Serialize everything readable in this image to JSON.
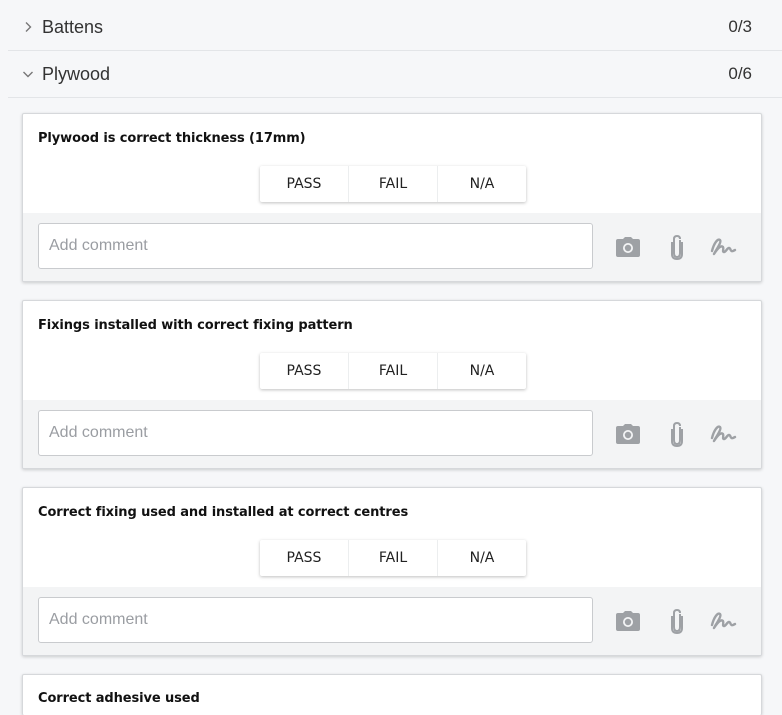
{
  "sections": [
    {
      "title": "Battens",
      "count": "0/3",
      "expanded": false
    },
    {
      "title": "Plywood",
      "count": "0/6",
      "expanded": true
    }
  ],
  "items": [
    {
      "question": "Plywood is correct thickness (17mm)"
    },
    {
      "question": "Fixings installed with correct fixing pattern"
    },
    {
      "question": "Correct fixing used and installed at correct centres"
    },
    {
      "question": "Correct adhesive used"
    }
  ],
  "options": {
    "pass": "PASS",
    "fail": "FAIL",
    "na": "N/A"
  },
  "comment_placeholder": "Add comment",
  "icons": {
    "camera": "camera-icon",
    "attach": "paperclip-icon",
    "signature": "signature-icon",
    "chevron_right": "chevron-right-icon",
    "chevron_down": "chevron-down-icon"
  },
  "colors": {
    "icon": "#9ea1a5",
    "footer_bg": "#f3f4f5",
    "page_bg": "#f6f7f9"
  }
}
